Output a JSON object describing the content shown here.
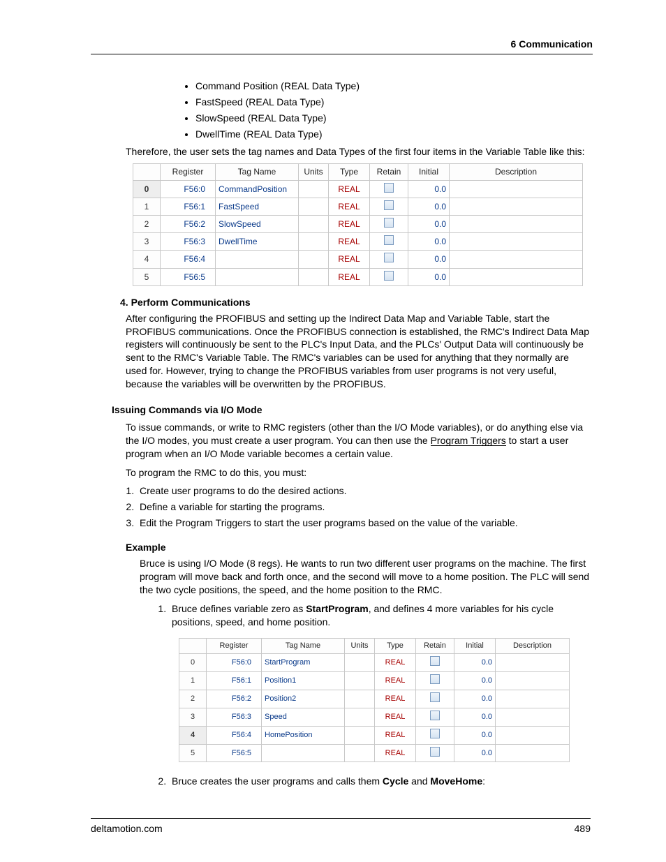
{
  "header": {
    "title": "6  Communication"
  },
  "bullets": [
    "Command Position (REAL Data Type)",
    "FastSpeed (REAL Data Type)",
    "SlowSpeed (REAL Data Type)",
    "DwellTime (REAL Data Type)"
  ],
  "para1": "Therefore, the user sets the tag names and Data Types of the first four items in the Variable Table like this:",
  "table1": {
    "headers": [
      "",
      "Register",
      "Tag Name",
      "Units",
      "Type",
      "Retain",
      "Initial",
      "Description"
    ],
    "rows": [
      {
        "idx": "0",
        "reg": "F56:0",
        "tag": "CommandPosition",
        "type": "REAL",
        "init": "0.0",
        "selected": true
      },
      {
        "idx": "1",
        "reg": "F56:1",
        "tag": "FastSpeed",
        "type": "REAL",
        "init": "0.0"
      },
      {
        "idx": "2",
        "reg": "F56:2",
        "tag": "SlowSpeed",
        "type": "REAL",
        "init": "0.0"
      },
      {
        "idx": "3",
        "reg": "F56:3",
        "tag": "DwellTime",
        "type": "REAL",
        "init": "0.0"
      },
      {
        "idx": "4",
        "reg": "F56:4",
        "tag": "",
        "type": "REAL",
        "init": "0.0"
      },
      {
        "idx": "5",
        "reg": "F56:5",
        "tag": "",
        "type": "REAL",
        "init": "0.0"
      }
    ]
  },
  "sec4": {
    "title": "4. Perform Communications",
    "body": "After configuring the PROFIBUS and setting up the Indirect Data Map and Variable Table, start the PROFIBUS communications. Once the PROFIBUS connection is established, the RMC's Indirect Data Map registers will continuously be sent to the PLC's Input Data, and the PLCs' Output Data will continuously be sent to the RMC's Variable Table. The RMC's variables can be used for anything that they normally are used for. However, trying to change the PROFIBUS variables from user programs is not very useful, because the variables will be overwritten by the PROFIBUS."
  },
  "h3": "Issuing Commands via I/O Mode",
  "io": {
    "p1a": "To issue commands, or write to RMC registers (other than the I/O Mode variables), or do anything else via the I/O modes, you must create a user program. You can then use the ",
    "p1_link": "Program Triggers",
    "p1b": " to start a user program when an I/O Mode variable becomes a certain value.",
    "p2": "To program the RMC to do this, you must:",
    "steps": [
      "Create user programs to do the desired actions.",
      "Define a variable for starting the programs.",
      "Edit the Program Triggers to start the user programs based on the value of the variable."
    ]
  },
  "example": {
    "title": "Example",
    "intro": "Bruce is using I/O Mode (8 regs). He wants to run two different user programs on the machine. The first program will move back and forth once, and the second will move to a home position. The PLC will send the two cycle positions, the speed, and the home position to the RMC.",
    "step1_a": "Bruce defines variable zero as ",
    "step1_bold": "StartProgram",
    "step1_b": ", and defines 4 more variables for his cycle positions, speed, and home position.",
    "step2_a": "Bruce creates the user programs and calls them ",
    "step2_bold1": "Cycle",
    "step2_mid": " and ",
    "step2_bold2": "MoveHome",
    "step2_b": ":"
  },
  "table2": {
    "headers": [
      "",
      "Register",
      "Tag Name",
      "Units",
      "Type",
      "Retain",
      "Initial",
      "Description"
    ],
    "rows": [
      {
        "idx": "0",
        "reg": "F56:0",
        "tag": "StartProgram",
        "type": "REAL",
        "init": "0.0"
      },
      {
        "idx": "1",
        "reg": "F56:1",
        "tag": "Position1",
        "type": "REAL",
        "init": "0.0"
      },
      {
        "idx": "2",
        "reg": "F56:2",
        "tag": "Position2",
        "type": "REAL",
        "init": "0.0"
      },
      {
        "idx": "3",
        "reg": "F56:3",
        "tag": "Speed",
        "type": "REAL",
        "init": "0.0"
      },
      {
        "idx": "4",
        "reg": "F56:4",
        "tag": "HomePosition",
        "type": "REAL",
        "init": "0.0",
        "selected": true
      },
      {
        "idx": "5",
        "reg": "F56:5",
        "tag": "",
        "type": "REAL",
        "init": "0.0"
      }
    ]
  },
  "footer": {
    "site": "deltamotion.com",
    "page": "489"
  }
}
